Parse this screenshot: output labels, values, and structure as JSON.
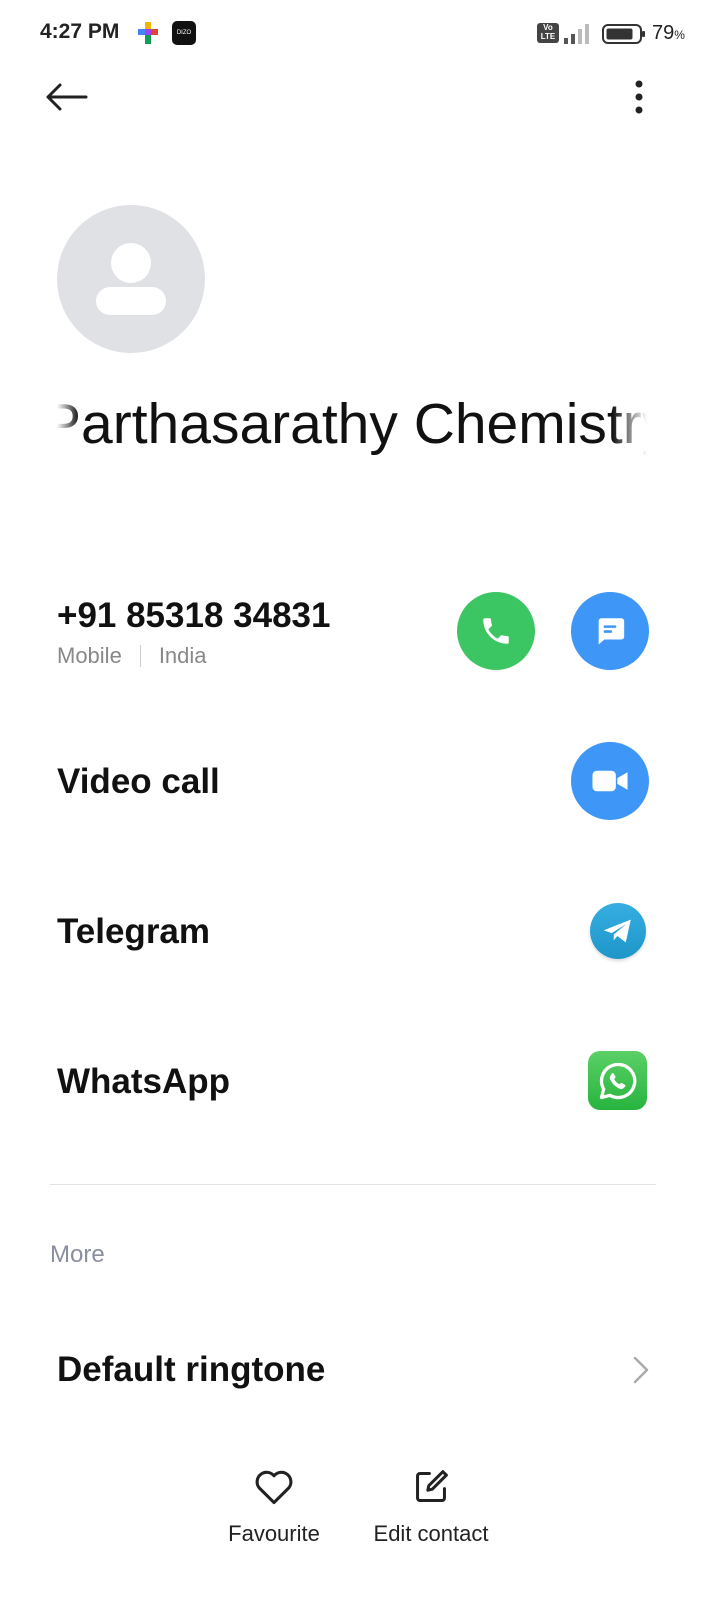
{
  "status_bar": {
    "time": "4:27 PM",
    "app_icon_2_text": "DIZO",
    "volte_text": "Vo LTE",
    "battery_percent": "79",
    "battery_unit": "%"
  },
  "contact": {
    "name": "Parthasarathy Chemistry"
  },
  "phone": {
    "number": "+91 85318 34831",
    "type": "Mobile",
    "region": "India"
  },
  "actions": {
    "video_call": "Video call",
    "telegram": "Telegram",
    "whatsapp": "WhatsApp"
  },
  "more_section": {
    "title": "More",
    "default_ringtone": "Default ringtone"
  },
  "bottom_bar": {
    "favourite": "Favourite",
    "edit_contact": "Edit contact"
  },
  "colors": {
    "call_green": "#3cc563",
    "accent_blue": "#3e97f7",
    "telegram_blue": "#2ba4dc",
    "whatsapp_green": "#27b43e",
    "avatar_gray": "#dfe1e5"
  },
  "icons": {
    "back": "arrow-left-icon",
    "more": "more-vertical-icon",
    "call": "phone-icon",
    "message": "message-icon",
    "video": "video-camera-icon",
    "telegram": "telegram-icon",
    "whatsapp": "whatsapp-icon",
    "chevron": "chevron-right-icon",
    "favourite": "heart-icon",
    "edit": "edit-icon"
  }
}
